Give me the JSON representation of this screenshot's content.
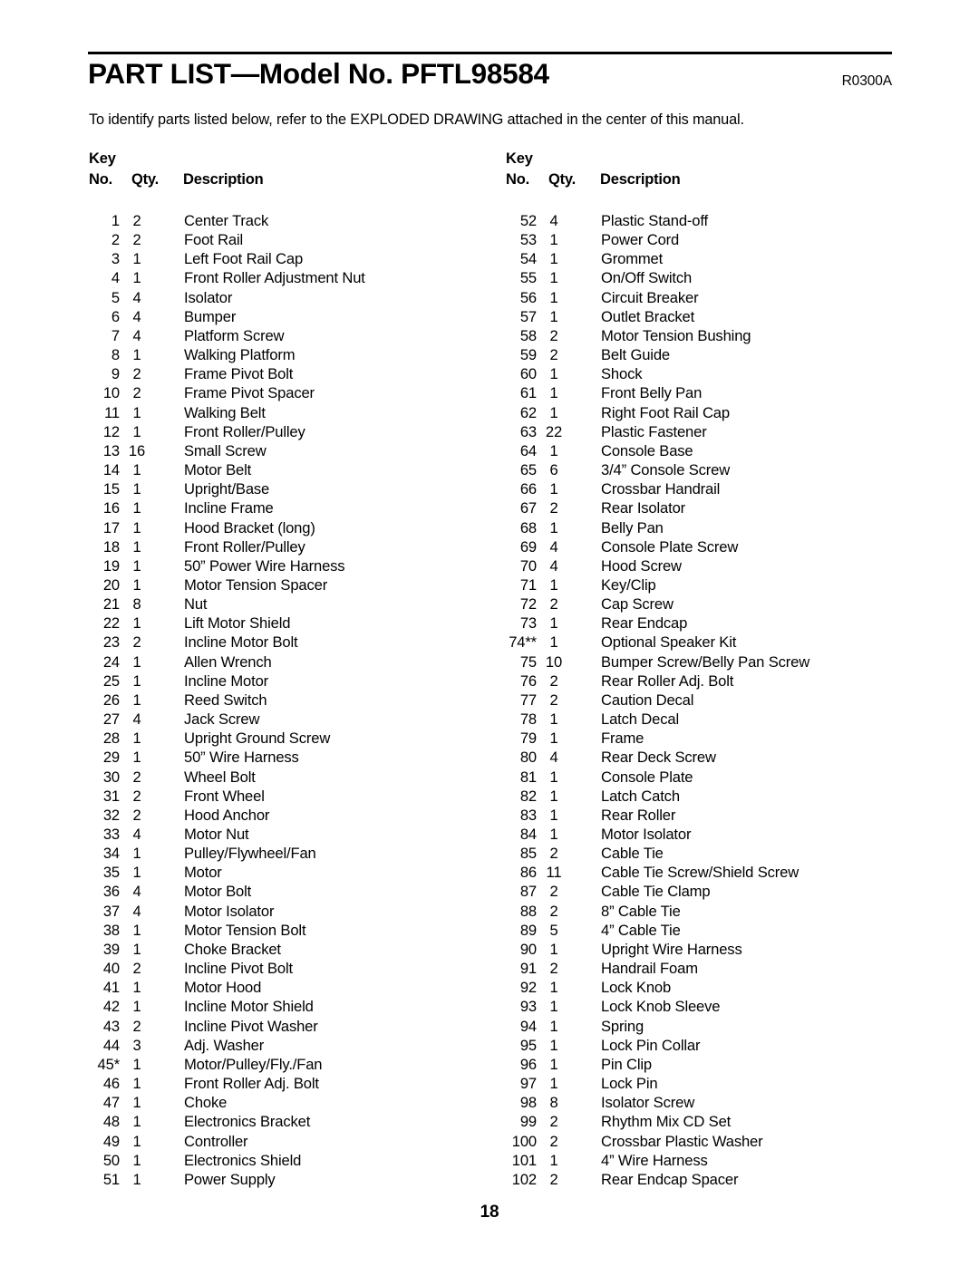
{
  "document": {
    "title": "PART LIST—Model No. PFTL98584",
    "revision_code": "R0300A",
    "intro": "To identify parts listed below, refer to the EXPLODED DRAWING attached in the center of this manual.",
    "page_number": "18"
  },
  "table": {
    "headers": {
      "key": "Key",
      "no": "No.",
      "qty": "Qty.",
      "description": "Description"
    },
    "left_column": [
      {
        "no": "1",
        "qty": "2",
        "description": "Center Track"
      },
      {
        "no": "2",
        "qty": "2",
        "description": "Foot Rail"
      },
      {
        "no": "3",
        "qty": "1",
        "description": "Left Foot Rail Cap"
      },
      {
        "no": "4",
        "qty": "1",
        "description": "Front Roller Adjustment Nut"
      },
      {
        "no": "5",
        "qty": "4",
        "description": "Isolator"
      },
      {
        "no": "6",
        "qty": "4",
        "description": "Bumper"
      },
      {
        "no": "7",
        "qty": "4",
        "description": "Platform Screw"
      },
      {
        "no": "8",
        "qty": "1",
        "description": "Walking Platform"
      },
      {
        "no": "9",
        "qty": "2",
        "description": "Frame Pivot Bolt"
      },
      {
        "no": "10",
        "qty": "2",
        "description": "Frame Pivot Spacer"
      },
      {
        "no": "11",
        "qty": "1",
        "description": "Walking Belt"
      },
      {
        "no": "12",
        "qty": "1",
        "description": "Front Roller/Pulley"
      },
      {
        "no": "13",
        "qty": "16",
        "description": "Small Screw"
      },
      {
        "no": "14",
        "qty": "1",
        "description": "Motor Belt"
      },
      {
        "no": "15",
        "qty": "1",
        "description": "Upright/Base"
      },
      {
        "no": "16",
        "qty": "1",
        "description": "Incline Frame"
      },
      {
        "no": "17",
        "qty": "1",
        "description": "Hood Bracket (long)"
      },
      {
        "no": "18",
        "qty": "1",
        "description": "Front Roller/Pulley"
      },
      {
        "no": "19",
        "qty": "1",
        "description": "50” Power Wire Harness"
      },
      {
        "no": "20",
        "qty": "1",
        "description": "Motor Tension Spacer"
      },
      {
        "no": "21",
        "qty": "8",
        "description": "Nut"
      },
      {
        "no": "22",
        "qty": "1",
        "description": "Lift Motor Shield"
      },
      {
        "no": "23",
        "qty": "2",
        "description": "Incline Motor Bolt"
      },
      {
        "no": "24",
        "qty": "1",
        "description": "Allen Wrench"
      },
      {
        "no": "25",
        "qty": "1",
        "description": "Incline Motor"
      },
      {
        "no": "26",
        "qty": "1",
        "description": "Reed Switch"
      },
      {
        "no": "27",
        "qty": "4",
        "description": "Jack Screw"
      },
      {
        "no": "28",
        "qty": "1",
        "description": "Upright Ground Screw"
      },
      {
        "no": "29",
        "qty": "1",
        "description": "50” Wire Harness"
      },
      {
        "no": "30",
        "qty": "2",
        "description": "Wheel Bolt"
      },
      {
        "no": "31",
        "qty": "2",
        "description": "Front Wheel"
      },
      {
        "no": "32",
        "qty": "2",
        "description": "Hood Anchor"
      },
      {
        "no": "33",
        "qty": "4",
        "description": "Motor Nut"
      },
      {
        "no": "34",
        "qty": "1",
        "description": "Pulley/Flywheel/Fan"
      },
      {
        "no": "35",
        "qty": "1",
        "description": "Motor"
      },
      {
        "no": "36",
        "qty": "4",
        "description": "Motor Bolt"
      },
      {
        "no": "37",
        "qty": "4",
        "description": "Motor Isolator"
      },
      {
        "no": "38",
        "qty": "1",
        "description": "Motor Tension Bolt"
      },
      {
        "no": "39",
        "qty": "1",
        "description": "Choke Bracket"
      },
      {
        "no": "40",
        "qty": "2",
        "description": "Incline Pivot Bolt"
      },
      {
        "no": "41",
        "qty": "1",
        "description": "Motor Hood"
      },
      {
        "no": "42",
        "qty": "1",
        "description": "Incline Motor Shield"
      },
      {
        "no": "43",
        "qty": "2",
        "description": "Incline Pivot Washer"
      },
      {
        "no": "44",
        "qty": "3",
        "description": "Adj. Washer"
      },
      {
        "no": "45*",
        "qty": "1",
        "description": "Motor/Pulley/Fly./Fan"
      },
      {
        "no": "46",
        "qty": "1",
        "description": "Front Roller Adj. Bolt"
      },
      {
        "no": "47",
        "qty": "1",
        "description": "Choke"
      },
      {
        "no": "48",
        "qty": "1",
        "description": "Electronics Bracket"
      },
      {
        "no": "49",
        "qty": "1",
        "description": "Controller"
      },
      {
        "no": "50",
        "qty": "1",
        "description": "Electronics Shield"
      },
      {
        "no": "51",
        "qty": "1",
        "description": "Power Supply"
      }
    ],
    "right_column": [
      {
        "no": "52",
        "qty": "4",
        "description": "Plastic Stand-off"
      },
      {
        "no": "53",
        "qty": "1",
        "description": "Power Cord"
      },
      {
        "no": "54",
        "qty": "1",
        "description": "Grommet"
      },
      {
        "no": "55",
        "qty": "1",
        "description": "On/Off Switch"
      },
      {
        "no": "56",
        "qty": "1",
        "description": "Circuit Breaker"
      },
      {
        "no": "57",
        "qty": "1",
        "description": "Outlet Bracket"
      },
      {
        "no": "58",
        "qty": "2",
        "description": "Motor Tension Bushing"
      },
      {
        "no": "59",
        "qty": "2",
        "description": "Belt Guide"
      },
      {
        "no": "60",
        "qty": "1",
        "description": "Shock"
      },
      {
        "no": "61",
        "qty": "1",
        "description": "Front Belly Pan"
      },
      {
        "no": "62",
        "qty": "1",
        "description": "Right Foot Rail Cap"
      },
      {
        "no": "63",
        "qty": "22",
        "description": "Plastic Fastener"
      },
      {
        "no": "64",
        "qty": "1",
        "description": "Console Base"
      },
      {
        "no": "65",
        "qty": "6",
        "description": "3/4” Console Screw"
      },
      {
        "no": "66",
        "qty": "1",
        "description": "Crossbar Handrail"
      },
      {
        "no": "67",
        "qty": "2",
        "description": "Rear Isolator"
      },
      {
        "no": "68",
        "qty": "1",
        "description": "Belly Pan"
      },
      {
        "no": "69",
        "qty": "4",
        "description": "Console Plate Screw"
      },
      {
        "no": "70",
        "qty": "4",
        "description": "Hood Screw"
      },
      {
        "no": "71",
        "qty": "1",
        "description": "Key/Clip"
      },
      {
        "no": "72",
        "qty": "2",
        "description": "Cap Screw"
      },
      {
        "no": "73",
        "qty": "1",
        "description": "Rear Endcap"
      },
      {
        "no": "74**",
        "qty": "1",
        "description": "Optional Speaker Kit"
      },
      {
        "no": "75",
        "qty": "10",
        "description": "Bumper Screw/Belly Pan Screw"
      },
      {
        "no": "76",
        "qty": "2",
        "description": "Rear Roller Adj. Bolt"
      },
      {
        "no": "77",
        "qty": "2",
        "description": "Caution Decal"
      },
      {
        "no": "78",
        "qty": "1",
        "description": "Latch Decal"
      },
      {
        "no": "79",
        "qty": "1",
        "description": "Frame"
      },
      {
        "no": "80",
        "qty": "4",
        "description": "Rear Deck Screw"
      },
      {
        "no": "81",
        "qty": "1",
        "description": "Console Plate"
      },
      {
        "no": "82",
        "qty": "1",
        "description": "Latch Catch"
      },
      {
        "no": "83",
        "qty": "1",
        "description": "Rear Roller"
      },
      {
        "no": "84",
        "qty": "1",
        "description": "Motor Isolator"
      },
      {
        "no": "85",
        "qty": "2",
        "description": "Cable Tie"
      },
      {
        "no": "86",
        "qty": "11",
        "description": "Cable Tie Screw/Shield Screw"
      },
      {
        "no": "87",
        "qty": "2",
        "description": "Cable Tie Clamp"
      },
      {
        "no": "88",
        "qty": "2",
        "description": "8” Cable Tie"
      },
      {
        "no": "89",
        "qty": "5",
        "description": "4” Cable Tie"
      },
      {
        "no": "90",
        "qty": "1",
        "description": "Upright Wire Harness"
      },
      {
        "no": "91",
        "qty": "2",
        "description": "Handrail Foam"
      },
      {
        "no": "92",
        "qty": "1",
        "description": "Lock Knob"
      },
      {
        "no": "93",
        "qty": "1",
        "description": "Lock Knob Sleeve"
      },
      {
        "no": "94",
        "qty": "1",
        "description": "Spring"
      },
      {
        "no": "95",
        "qty": "1",
        "description": "Lock Pin Collar"
      },
      {
        "no": "96",
        "qty": "1",
        "description": "Pin Clip"
      },
      {
        "no": "97",
        "qty": "1",
        "description": "Lock Pin"
      },
      {
        "no": "98",
        "qty": "8",
        "description": "Isolator Screw"
      },
      {
        "no": "99",
        "qty": "2",
        "description": "Rhythm Mix CD Set"
      },
      {
        "no": "100",
        "qty": "2",
        "description": "Crossbar Plastic Washer"
      },
      {
        "no": "101",
        "qty": "1",
        "description": "4” Wire Harness"
      },
      {
        "no": "102",
        "qty": "2",
        "description": "Rear Endcap Spacer"
      }
    ]
  }
}
